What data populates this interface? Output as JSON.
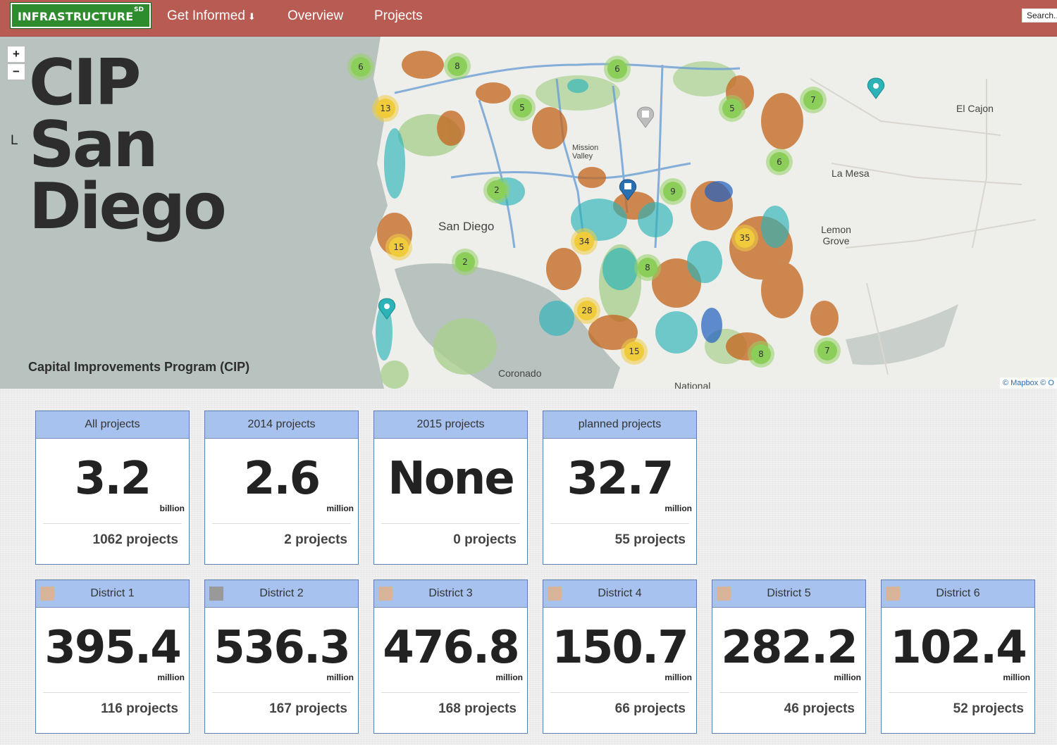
{
  "navbar": {
    "logo": "INFRASTRUCTURE",
    "logo_sup": "SD",
    "links": [
      {
        "label": "Get Informed",
        "caret": "🡇"
      },
      {
        "label": "Overview"
      },
      {
        "label": "Projects"
      }
    ],
    "search_placeholder": "Search..."
  },
  "map": {
    "title": "CIP San Diego",
    "subtitle": "Capital Improvements Program (CIP)",
    "zoom_in": "+",
    "zoom_out": "−",
    "layers": "L",
    "attribution": "© Mapbox © O",
    "places": [
      "El Cajon",
      "La Mesa",
      "San Diego",
      "Lemon Grove",
      "Coronado",
      "Mission Valley",
      "National"
    ],
    "clusters": [
      "6",
      "8",
      "6",
      "13",
      "5",
      "5",
      "7",
      "6",
      "2",
      "9",
      "35",
      "15",
      "2",
      "34",
      "8",
      "28",
      "15",
      "8",
      "7"
    ]
  },
  "summary_cards": [
    {
      "title": "All projects",
      "value": "3.2",
      "unit": "billion",
      "count": "1062 projects"
    },
    {
      "title": "2014 projects",
      "value": "2.6",
      "unit": "million",
      "count": "2 projects"
    },
    {
      "title": "2015 projects",
      "value": "None",
      "unit": "",
      "count": "0 projects"
    },
    {
      "title": "planned projects",
      "value": "32.7",
      "unit": "million",
      "count": "55 projects"
    }
  ],
  "district_cards": [
    {
      "title": "District 1",
      "value": "395.4",
      "unit": "million",
      "count": "116 projects"
    },
    {
      "title": "District 2",
      "value": "536.3",
      "unit": "million",
      "count": "167 projects"
    },
    {
      "title": "District 3",
      "value": "476.8",
      "unit": "million",
      "count": "168 projects"
    },
    {
      "title": "District 4",
      "value": "150.7",
      "unit": "million",
      "count": "66 projects"
    },
    {
      "title": "District 5",
      "value": "282.2",
      "unit": "million",
      "count": "46 projects"
    },
    {
      "title": "District 6",
      "value": "102.4",
      "unit": "million",
      "count": "52 projects"
    }
  ]
}
